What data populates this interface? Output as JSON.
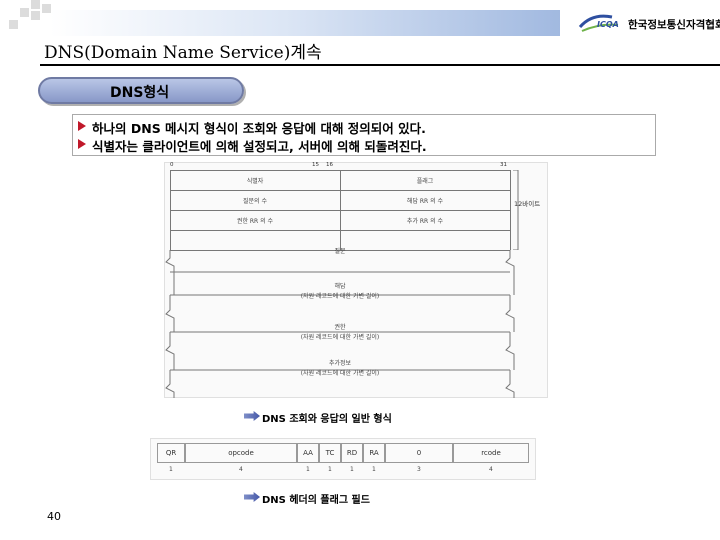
{
  "header": {
    "logo_mark": "ICQA",
    "logo_text": "한국정보통신자격협회"
  },
  "title": "DNS(Domain Name Service)계속",
  "section_pill": "DNS형식",
  "bullets": [
    "하나의 DNS 메시지 형식이 조회와 응답에 대해 정의되어 있다.",
    "식별자는 클라이언트에 의해 설정되고, 서버에 의해 되돌려진다."
  ],
  "diagram": {
    "bit_labels": [
      "0",
      "15",
      "16",
      "31"
    ],
    "fields": [
      "식별자",
      "플래그",
      "질문의 수",
      "해답 RR 의 수",
      "권한 RR 의 수",
      "추가 RR 의 수"
    ],
    "size_label": "12바이트",
    "sections": [
      {
        "name": "질문",
        "note": ""
      },
      {
        "name": "해답",
        "note": "(자원 레코드에 대한 가변 길이)"
      },
      {
        "name": "권한",
        "note": "(자원 레코드에 대한 가변 길이)"
      },
      {
        "name": "추가정보",
        "note": "(자원 레코드에 대한 가변 길이)"
      }
    ],
    "caption": "DNS 조회와 응답의 일반 형식"
  },
  "flags": {
    "cells": [
      "QR",
      "opcode",
      "AA",
      "TC",
      "RD",
      "RA",
      "0",
      "rcode"
    ],
    "bits": [
      "1",
      "4",
      "1",
      "1",
      "1",
      "1",
      "3",
      "4"
    ],
    "caption": "DNS 헤더의 플래그 필드"
  },
  "page_number": "40",
  "colors": {
    "accent": "#c0182a",
    "pill": "#8898c8",
    "header_bar": "#7f9fd4"
  }
}
